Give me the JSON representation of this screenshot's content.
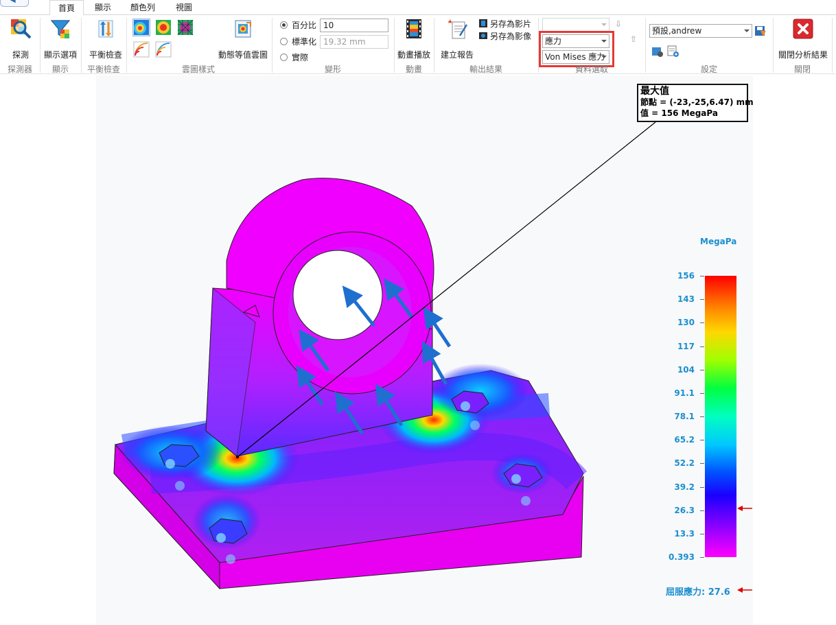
{
  "tabs": [
    {
      "label": "首頁",
      "active": true
    },
    {
      "label": "顯示",
      "active": false
    },
    {
      "label": "顏色列",
      "active": false
    },
    {
      "label": "視圖",
      "active": false
    }
  ],
  "groups": {
    "probe": {
      "button": "探測",
      "label": "探測器"
    },
    "display": {
      "button": "顯示選項",
      "label": "顯示"
    },
    "balance": {
      "button": "平衡檢查",
      "label": "平衡檢查"
    },
    "contour": {
      "button": "動態等值雲圖",
      "label": "雲圖樣式"
    },
    "deform": {
      "label": "變形",
      "opt_percent": "百分比",
      "percent_value": "10",
      "opt_normalized": "標準化",
      "normalized_value": "19.32 mm",
      "opt_actual": "實際"
    },
    "animation": {
      "button": "動畫播放",
      "label": "動畫"
    },
    "output": {
      "label": "輸出結果",
      "create_report": "建立報告",
      "save_movie": "另存為影片",
      "save_image": "另存為影像"
    },
    "data": {
      "label": "資料選取",
      "result_type": "應力",
      "component": "Von Mises 應力"
    },
    "settings": {
      "label": "設定",
      "profile": "預設,andrew"
    },
    "close": {
      "button": "關閉分析結果",
      "label": "關閉"
    }
  },
  "callout": {
    "title": "最大值",
    "node": "節點 = (-23,-25,6.47) mm",
    "value": "值 = 156 MegaPa"
  },
  "legend": {
    "unit": "MegaPa",
    "ticks": [
      "156",
      "143",
      "130",
      "117",
      "104",
      "91.1",
      "78.1",
      "65.2",
      "52.2",
      "39.2",
      "26.3",
      "13.3",
      "0.393"
    ],
    "yield_label": "屈服應力: 27.6",
    "yield_value": 27.6
  },
  "colors": {
    "accent_blue": "#1a8fd0",
    "highlight_red": "#e53935",
    "close_red": "#d9282f"
  },
  "icons": {
    "probe": "magnifier-icon",
    "display": "funnel-icon",
    "balance": "balance-check-icon",
    "animation": "film-icon",
    "close": "close-x-icon"
  }
}
